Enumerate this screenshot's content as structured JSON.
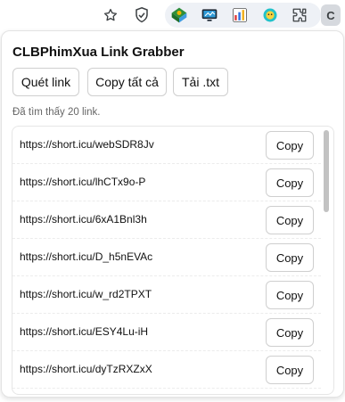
{
  "browser": {
    "icons": [
      "star-icon",
      "shield-icon",
      "download-manager-icon",
      "monitor-icon",
      "chart-extension-icon",
      "smiley-extension-icon",
      "puzzle-icon",
      "c-profile-icon"
    ],
    "profile_letter": "C"
  },
  "popup": {
    "title": "CLBPhimXua Link Grabber",
    "buttons": {
      "scan": "Quét link",
      "copy_all": "Copy tất cả",
      "download_txt": "Tải .txt"
    },
    "status": "Đã tìm thấy 20 link.",
    "links": [
      {
        "url": "https://short.icu/webSDR8Jv",
        "action": "Copy"
      },
      {
        "url": "https://short.icu/lhCTx9o-P",
        "action": "Copy"
      },
      {
        "url": "https://short.icu/6xA1Bnl3h",
        "action": "Copy"
      },
      {
        "url": "https://short.icu/D_h5nEVAc",
        "action": "Copy"
      },
      {
        "url": "https://short.icu/w_rd2TPXT",
        "action": "Copy"
      },
      {
        "url": "https://short.icu/ESY4Lu-iH",
        "action": "Copy"
      },
      {
        "url": "https://short.icu/dyTzRXZxX",
        "action": "Copy"
      }
    ]
  }
}
